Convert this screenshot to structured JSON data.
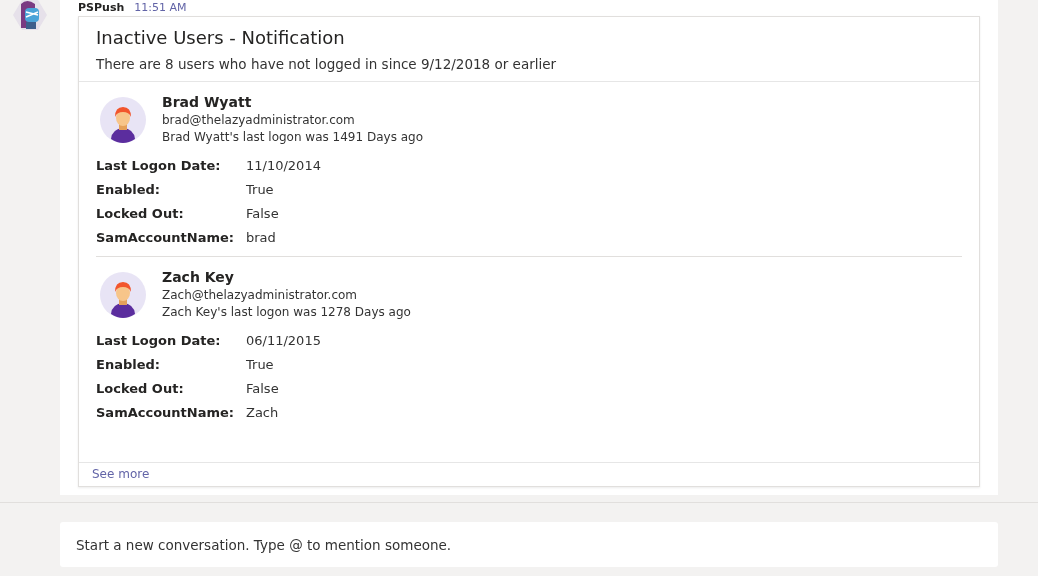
{
  "message": {
    "sender": "PSPush",
    "time": "11:51 AM"
  },
  "card": {
    "title": "Inactive Users - Notification",
    "subtitle": "There are 8 users who have not logged in since 9/12/2018 or earlier",
    "users": [
      {
        "name": "Brad Wyatt",
        "email": "brad@thelazyadministrator.com",
        "summary": "Brad Wyatt's last logon was 1491 Days ago",
        "facts": [
          {
            "label": "Last Logon Date:",
            "value": "11/10/2014"
          },
          {
            "label": "Enabled:",
            "value": "True"
          },
          {
            "label": "Locked Out:",
            "value": "False"
          },
          {
            "label": "SamAccountName:",
            "value": "brad"
          }
        ]
      },
      {
        "name": "Zach Key",
        "email": "Zach@thelazyadministrator.com",
        "summary": "Zach Key's last logon was 1278 Days ago",
        "facts": [
          {
            "label": "Last Logon Date:",
            "value": "06/11/2015"
          },
          {
            "label": "Enabled:",
            "value": "True"
          },
          {
            "label": "Locked Out:",
            "value": "False"
          },
          {
            "label": "SamAccountName:",
            "value": "Zach"
          }
        ]
      }
    ],
    "see_more": "See more"
  },
  "compose": {
    "placeholder": "Start a new conversation. Type @ to mention someone."
  }
}
